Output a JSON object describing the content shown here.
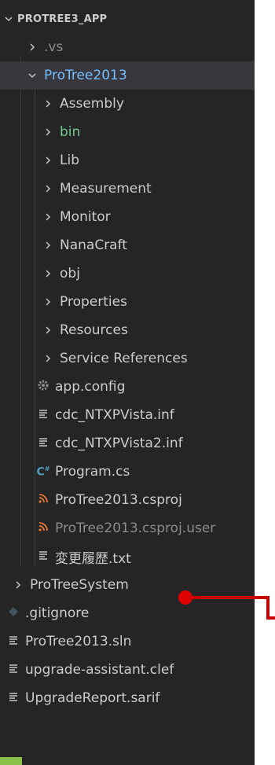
{
  "explorer": {
    "root_label": "PROTREE3_APP",
    "items": [
      {
        "label": ".vs",
        "icon": "chevron-right-icon",
        "style": "dim"
      },
      {
        "label": "ProTree2013",
        "icon": "chevron-down-icon",
        "style": "blue"
      },
      {
        "label": "Assembly",
        "icon": "chevron-right-icon",
        "style": ""
      },
      {
        "label": "bin",
        "icon": "chevron-right-icon",
        "style": "green"
      },
      {
        "label": "Lib",
        "icon": "chevron-right-icon",
        "style": ""
      },
      {
        "label": "Measurement",
        "icon": "chevron-right-icon",
        "style": ""
      },
      {
        "label": "Monitor",
        "icon": "chevron-right-icon",
        "style": ""
      },
      {
        "label": "NanaCraft",
        "icon": "chevron-right-icon",
        "style": ""
      },
      {
        "label": "obj",
        "icon": "chevron-right-icon",
        "style": ""
      },
      {
        "label": "Properties",
        "icon": "chevron-right-icon",
        "style": ""
      },
      {
        "label": "Resources",
        "icon": "chevron-right-icon",
        "style": ""
      },
      {
        "label": "Service References",
        "icon": "chevron-right-icon",
        "style": ""
      },
      {
        "label": "app.config",
        "icon": "gear-icon",
        "style": ""
      },
      {
        "label": "cdc_NTXPVista.inf",
        "icon": "text-file-icon",
        "style": ""
      },
      {
        "label": "cdc_NTXPVista2.inf",
        "icon": "text-file-icon",
        "style": ""
      },
      {
        "label": "Program.cs",
        "icon": "csharp-file-icon",
        "style": ""
      },
      {
        "label": "ProTree2013.csproj",
        "icon": "rss-icon",
        "style": ""
      },
      {
        "label": "ProTree2013.csproj.user",
        "icon": "rss-icon",
        "style": "dim"
      },
      {
        "label": "変更履歴.txt",
        "icon": "text-file-icon",
        "style": ""
      },
      {
        "label": "ProTreeSystem",
        "icon": "chevron-right-icon",
        "style": ""
      },
      {
        "label": ".gitignore",
        "icon": "git-diamond-icon",
        "style": ""
      },
      {
        "label": "ProTree2013.sln",
        "icon": "text-file-icon",
        "style": ""
      },
      {
        "label": "upgrade-assistant.clef",
        "icon": "text-file-icon",
        "style": ""
      },
      {
        "label": "UpgradeReport.sarif",
        "icon": "text-file-icon",
        "style": ""
      }
    ]
  },
  "colors": {
    "background": "#252526",
    "text": "#cccccc",
    "dim_text": "#8c8c8c",
    "folder_open": "#75beff",
    "git_untracked": "#73c991",
    "csharp_icon": "#519aba",
    "rss_icon": "#e37933",
    "annotation": "#cc0000"
  }
}
